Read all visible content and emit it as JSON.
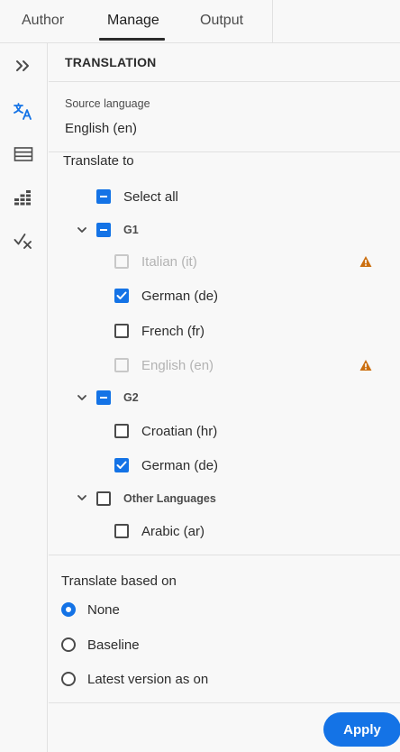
{
  "tabs": [
    {
      "label": "Author",
      "active": false
    },
    {
      "label": "Manage",
      "active": true
    },
    {
      "label": "Output",
      "active": false
    }
  ],
  "rail": {
    "icons": [
      "expand-panel-icon",
      "translate-icon",
      "list-icon",
      "report-icon",
      "review-check-icon"
    ]
  },
  "panel": {
    "title": "TRANSLATION",
    "source_language_label": "Source language",
    "source_language_value": "English (en)",
    "translate_to_label": "Translate to",
    "select_all": {
      "label": "Select all",
      "state": "partial"
    },
    "groups": [
      {
        "name": "G1",
        "expanded": true,
        "state": "partial",
        "languages": [
          {
            "label": "Italian (it)",
            "checked": false,
            "disabled": true,
            "warning": true
          },
          {
            "label": "German (de)",
            "checked": true,
            "disabled": false,
            "warning": false
          },
          {
            "label": "French (fr)",
            "checked": false,
            "disabled": false,
            "warning": false
          },
          {
            "label": "English (en)",
            "checked": false,
            "disabled": true,
            "warning": true
          }
        ]
      },
      {
        "name": "G2",
        "expanded": true,
        "state": "partial",
        "languages": [
          {
            "label": "Croatian (hr)",
            "checked": false,
            "disabled": false,
            "warning": false
          },
          {
            "label": "German (de)",
            "checked": true,
            "disabled": false,
            "warning": false
          }
        ]
      },
      {
        "name": "Other Languages",
        "expanded": true,
        "state": "unchecked",
        "languages": [
          {
            "label": "Arabic (ar)",
            "checked": false,
            "disabled": false,
            "warning": false
          }
        ]
      }
    ],
    "translate_based_on_label": "Translate based on",
    "based_on_options": [
      {
        "label": "None",
        "selected": true
      },
      {
        "label": "Baseline",
        "selected": false
      },
      {
        "label": "Latest version as on",
        "selected": false
      }
    ],
    "apply_label": "Apply"
  },
  "colors": {
    "accent": "#1473e6",
    "warning": "#cb6f10",
    "background": "#f8f8f8",
    "divider": "#e1e1e1"
  }
}
